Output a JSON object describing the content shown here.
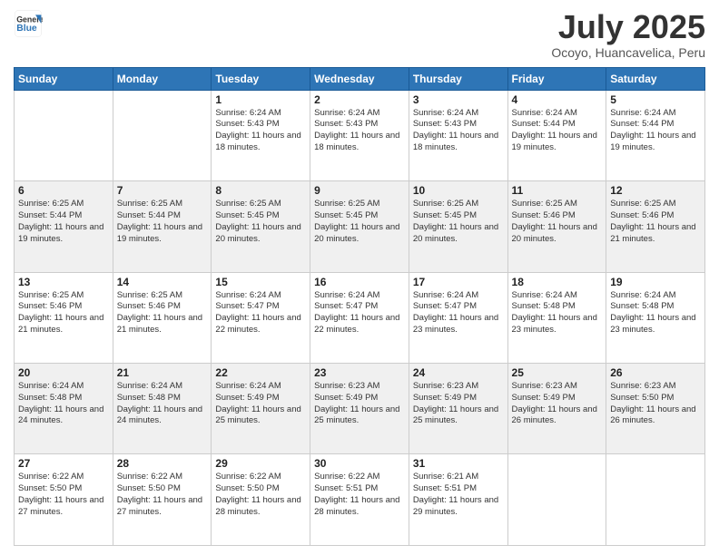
{
  "header": {
    "logo_line1": "General",
    "logo_line2": "Blue",
    "month_title": "July 2025",
    "location": "Ocoyo, Huancavelica, Peru"
  },
  "weekdays": [
    "Sunday",
    "Monday",
    "Tuesday",
    "Wednesday",
    "Thursday",
    "Friday",
    "Saturday"
  ],
  "weeks": [
    [
      {
        "day": null,
        "info": null
      },
      {
        "day": null,
        "info": null
      },
      {
        "day": "1",
        "sunrise": "6:24 AM",
        "sunset": "5:43 PM",
        "daylight": "11 hours and 18 minutes."
      },
      {
        "day": "2",
        "sunrise": "6:24 AM",
        "sunset": "5:43 PM",
        "daylight": "11 hours and 18 minutes."
      },
      {
        "day": "3",
        "sunrise": "6:24 AM",
        "sunset": "5:43 PM",
        "daylight": "11 hours and 18 minutes."
      },
      {
        "day": "4",
        "sunrise": "6:24 AM",
        "sunset": "5:44 PM",
        "daylight": "11 hours and 19 minutes."
      },
      {
        "day": "5",
        "sunrise": "6:24 AM",
        "sunset": "5:44 PM",
        "daylight": "11 hours and 19 minutes."
      }
    ],
    [
      {
        "day": "6",
        "sunrise": "6:25 AM",
        "sunset": "5:44 PM",
        "daylight": "11 hours and 19 minutes."
      },
      {
        "day": "7",
        "sunrise": "6:25 AM",
        "sunset": "5:44 PM",
        "daylight": "11 hours and 19 minutes."
      },
      {
        "day": "8",
        "sunrise": "6:25 AM",
        "sunset": "5:45 PM",
        "daylight": "11 hours and 20 minutes."
      },
      {
        "day": "9",
        "sunrise": "6:25 AM",
        "sunset": "5:45 PM",
        "daylight": "11 hours and 20 minutes."
      },
      {
        "day": "10",
        "sunrise": "6:25 AM",
        "sunset": "5:45 PM",
        "daylight": "11 hours and 20 minutes."
      },
      {
        "day": "11",
        "sunrise": "6:25 AM",
        "sunset": "5:46 PM",
        "daylight": "11 hours and 20 minutes."
      },
      {
        "day": "12",
        "sunrise": "6:25 AM",
        "sunset": "5:46 PM",
        "daylight": "11 hours and 21 minutes."
      }
    ],
    [
      {
        "day": "13",
        "sunrise": "6:25 AM",
        "sunset": "5:46 PM",
        "daylight": "11 hours and 21 minutes."
      },
      {
        "day": "14",
        "sunrise": "6:25 AM",
        "sunset": "5:46 PM",
        "daylight": "11 hours and 21 minutes."
      },
      {
        "day": "15",
        "sunrise": "6:24 AM",
        "sunset": "5:47 PM",
        "daylight": "11 hours and 22 minutes."
      },
      {
        "day": "16",
        "sunrise": "6:24 AM",
        "sunset": "5:47 PM",
        "daylight": "11 hours and 22 minutes."
      },
      {
        "day": "17",
        "sunrise": "6:24 AM",
        "sunset": "5:47 PM",
        "daylight": "11 hours and 23 minutes."
      },
      {
        "day": "18",
        "sunrise": "6:24 AM",
        "sunset": "5:48 PM",
        "daylight": "11 hours and 23 minutes."
      },
      {
        "day": "19",
        "sunrise": "6:24 AM",
        "sunset": "5:48 PM",
        "daylight": "11 hours and 23 minutes."
      }
    ],
    [
      {
        "day": "20",
        "sunrise": "6:24 AM",
        "sunset": "5:48 PM",
        "daylight": "11 hours and 24 minutes."
      },
      {
        "day": "21",
        "sunrise": "6:24 AM",
        "sunset": "5:48 PM",
        "daylight": "11 hours and 24 minutes."
      },
      {
        "day": "22",
        "sunrise": "6:24 AM",
        "sunset": "5:49 PM",
        "daylight": "11 hours and 25 minutes."
      },
      {
        "day": "23",
        "sunrise": "6:23 AM",
        "sunset": "5:49 PM",
        "daylight": "11 hours and 25 minutes."
      },
      {
        "day": "24",
        "sunrise": "6:23 AM",
        "sunset": "5:49 PM",
        "daylight": "11 hours and 25 minutes."
      },
      {
        "day": "25",
        "sunrise": "6:23 AM",
        "sunset": "5:49 PM",
        "daylight": "11 hours and 26 minutes."
      },
      {
        "day": "26",
        "sunrise": "6:23 AM",
        "sunset": "5:50 PM",
        "daylight": "11 hours and 26 minutes."
      }
    ],
    [
      {
        "day": "27",
        "sunrise": "6:22 AM",
        "sunset": "5:50 PM",
        "daylight": "11 hours and 27 minutes."
      },
      {
        "day": "28",
        "sunrise": "6:22 AM",
        "sunset": "5:50 PM",
        "daylight": "11 hours and 27 minutes."
      },
      {
        "day": "29",
        "sunrise": "6:22 AM",
        "sunset": "5:50 PM",
        "daylight": "11 hours and 28 minutes."
      },
      {
        "day": "30",
        "sunrise": "6:22 AM",
        "sunset": "5:51 PM",
        "daylight": "11 hours and 28 minutes."
      },
      {
        "day": "31",
        "sunrise": "6:21 AM",
        "sunset": "5:51 PM",
        "daylight": "11 hours and 29 minutes."
      },
      {
        "day": null,
        "info": null
      },
      {
        "day": null,
        "info": null
      }
    ]
  ]
}
